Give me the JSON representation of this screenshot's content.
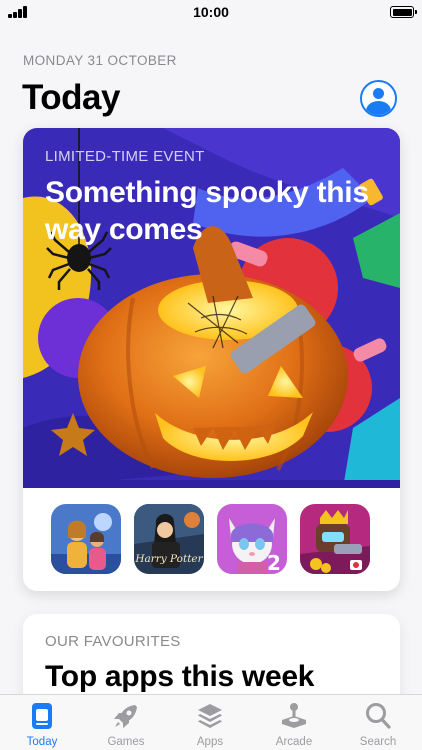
{
  "status_bar": {
    "time": "10:00"
  },
  "header": {
    "date": "MONDAY 31 OCTOBER",
    "title": "Today",
    "account_icon": "person-circle-icon"
  },
  "featured": {
    "kicker": "LIMITED-TIME EVENT",
    "title": "Something spooky this way comes",
    "apps": [
      {
        "name": "family-game-icon"
      },
      {
        "name": "harry-potter-icon",
        "label": "Harry Potter"
      },
      {
        "name": "talking-angela-2-icon",
        "label": "2"
      },
      {
        "name": "crowned-robot-game-icon"
      }
    ]
  },
  "favourites": {
    "kicker": "OUR FAVOURITES",
    "title": "Top apps this week"
  },
  "tab_bar": {
    "items": [
      {
        "label": "Today",
        "icon": "today-icon",
        "active": true
      },
      {
        "label": "Games",
        "icon": "rocket-icon",
        "active": false
      },
      {
        "label": "Apps",
        "icon": "layers-icon",
        "active": false
      },
      {
        "label": "Arcade",
        "icon": "joystick-icon",
        "active": false
      },
      {
        "label": "Search",
        "icon": "search-icon",
        "active": false
      }
    ]
  },
  "colors": {
    "accent": "#1a7cf5",
    "background": "#f6f6f8",
    "event_bg": "#3a2ab8"
  }
}
